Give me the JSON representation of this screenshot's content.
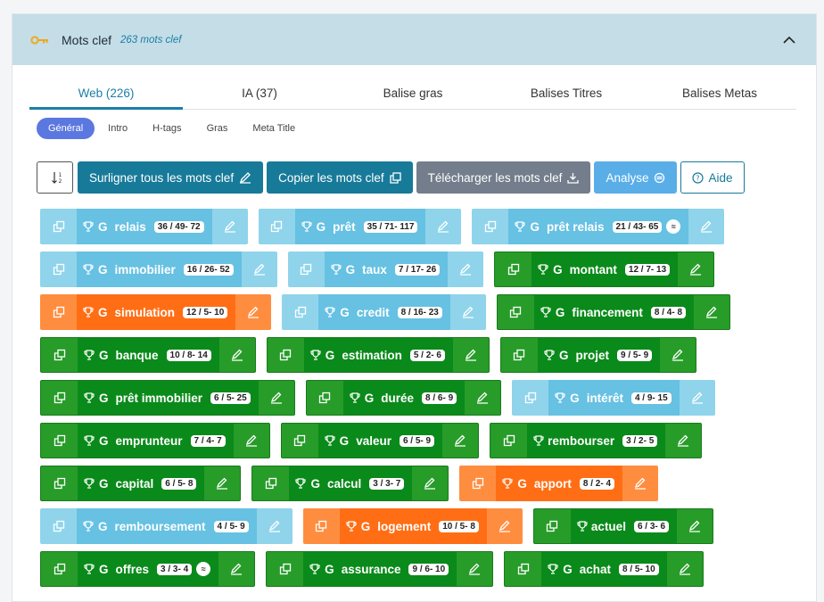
{
  "header": {
    "title": "Mots clef",
    "count": "263 mots clef"
  },
  "tabs": [
    {
      "label": "Web (226)",
      "active": true
    },
    {
      "label": "IA (37)",
      "active": false
    },
    {
      "label": "Balise gras",
      "active": false
    },
    {
      "label": "Balises Titres",
      "active": false
    },
    {
      "label": "Balises Metas",
      "active": false
    }
  ],
  "subtabs": [
    {
      "label": "Général",
      "active": true
    },
    {
      "label": "Intro",
      "active": false
    },
    {
      "label": "H-tags",
      "active": false
    },
    {
      "label": "Gras",
      "active": false
    },
    {
      "label": "Meta Title",
      "active": false
    }
  ],
  "toolbar": {
    "highlight_label": "Surligner tous les mots clef",
    "copy_label": "Copier les mots clef",
    "download_label": "Télécharger les mots clef",
    "analyse_label": "Analyse",
    "help_label": "Aide"
  },
  "colors": {
    "green": "#0a8a1a",
    "blue": "#66c1e2",
    "orange": "#ff6e15",
    "teal": "#177a99"
  },
  "keyword_rows": [
    [
      {
        "word": "relais",
        "stats": "36 / 49- 72",
        "color": "blue",
        "g": "G",
        "approx": ""
      },
      {
        "word": "prêt",
        "stats": "35 / 71- 117",
        "color": "blue",
        "g": "G",
        "approx": ""
      },
      {
        "word": "prêt relais",
        "stats": "21 / 43- 65",
        "color": "blue",
        "g": "G",
        "approx": "≈"
      }
    ],
    [
      {
        "word": "immobilier",
        "stats": "16 / 26- 52",
        "color": "blue",
        "g": "G",
        "approx": ""
      },
      {
        "word": "taux",
        "stats": "7 / 17- 26",
        "color": "blue",
        "g": "G",
        "approx": ""
      },
      {
        "word": "montant",
        "stats": "12 / 7- 13",
        "color": "green",
        "g": "G",
        "approx": ""
      }
    ],
    [
      {
        "word": "simulation",
        "stats": "12 / 5- 10",
        "color": "orange",
        "g": "G",
        "approx": ""
      },
      {
        "word": "credit",
        "stats": "8 / 16- 23",
        "color": "blue",
        "g": "G",
        "approx": ""
      },
      {
        "word": "financement",
        "stats": "8 / 4- 8",
        "color": "green",
        "g": "G",
        "approx": ""
      }
    ],
    [
      {
        "word": "banque",
        "stats": "10 / 8- 14",
        "color": "green",
        "g": "G",
        "approx": ""
      },
      {
        "word": "estimation",
        "stats": "5 / 2- 6",
        "color": "green",
        "g": "G",
        "approx": ""
      },
      {
        "word": "projet",
        "stats": "9 / 5- 9",
        "color": "green",
        "g": "G",
        "approx": ""
      }
    ],
    [
      {
        "word": "prêt immobilier",
        "stats": "6 / 5- 25",
        "color": "green",
        "g": "G",
        "approx": ""
      },
      {
        "word": "durée",
        "stats": "8 / 6- 9",
        "color": "green",
        "g": "G",
        "approx": ""
      },
      {
        "word": "intérêt",
        "stats": "4 / 9- 15",
        "color": "blue",
        "g": "G",
        "approx": ""
      }
    ],
    [
      {
        "word": "emprunteur",
        "stats": "7 / 4- 7",
        "color": "green",
        "g": "G",
        "approx": ""
      },
      {
        "word": "valeur",
        "stats": "6 / 5- 9",
        "color": "green",
        "g": "G",
        "approx": ""
      },
      {
        "word": "rembourser",
        "stats": "3 / 2- 5",
        "color": "green",
        "g": "",
        "approx": ""
      }
    ],
    [
      {
        "word": "capital",
        "stats": "6 / 5- 8",
        "color": "green",
        "g": "G",
        "approx": ""
      },
      {
        "word": "calcul",
        "stats": "3 / 3- 7",
        "color": "green",
        "g": "G",
        "approx": ""
      },
      {
        "word": "apport",
        "stats": "8 / 2- 4",
        "color": "orange",
        "g": "G",
        "approx": ""
      }
    ],
    [
      {
        "word": "remboursement",
        "stats": "4 / 5- 9",
        "color": "blue",
        "g": "G",
        "approx": ""
      },
      {
        "word": "logement",
        "stats": "10 / 5- 8",
        "color": "orange",
        "g": "G",
        "approx": ""
      },
      {
        "word": "actuel",
        "stats": "6 / 3- 6",
        "color": "green",
        "g": "",
        "approx": ""
      }
    ],
    [
      {
        "word": "offres",
        "stats": "3 / 3- 4",
        "color": "green",
        "g": "G",
        "approx": "≈"
      },
      {
        "word": "assurance",
        "stats": "9 / 6- 10",
        "color": "green",
        "g": "G",
        "approx": ""
      },
      {
        "word": "achat",
        "stats": "8 / 5- 10",
        "color": "green",
        "g": "G",
        "approx": ""
      }
    ]
  ]
}
